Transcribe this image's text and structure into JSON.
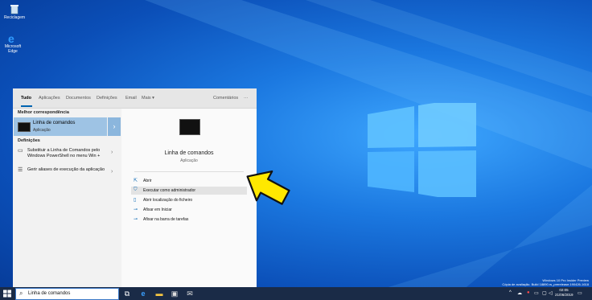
{
  "desktop": {
    "icons": [
      {
        "label": "Reciclagem",
        "icon": "recycle-bin-icon"
      },
      {
        "label": "Microsoft Edge",
        "icon": "edge-icon"
      }
    ],
    "watermark": {
      "line1": "Windows 10 Pro Insider Preview",
      "line2": "Cópia de avaliação. Build 18890.rs_prerelease.190426-1618"
    }
  },
  "search_panel": {
    "tabs": [
      "Tudo",
      "Aplicações",
      "Documentos",
      "Definições",
      "Email",
      "Mais ▾"
    ],
    "feedback": "Comentários",
    "more_options": "···",
    "best_match_header": "Melhor correspondência",
    "best_match": {
      "title": "Linha de comandos",
      "subtitle": "Aplicação"
    },
    "settings_header": "Definições",
    "settings_items": [
      {
        "text": "Substituir a Linha de Comandos pelo Windows PowerShell no menu Win +",
        "icon": "monitor-icon"
      },
      {
        "text": "Gerir aliases de execução da aplicação",
        "icon": "list-icon"
      }
    ],
    "preview": {
      "title": "Linha de comandos",
      "subtitle": "Aplicação",
      "actions": [
        {
          "label": "Abrir",
          "icon": "open-icon"
        },
        {
          "label": "Executar como administrador",
          "icon": "shield-run-icon"
        },
        {
          "label": "Abrir localização do ficheiro",
          "icon": "file-location-icon"
        },
        {
          "label": "Afixar em Iniciar",
          "icon": "pin-icon"
        },
        {
          "label": "Afixar na barra de tarefas",
          "icon": "pin-taskbar-icon"
        }
      ]
    }
  },
  "taskbar": {
    "search_value": "Linha de comandos",
    "clock_time": "02:05",
    "clock_date": "21/06/2019"
  },
  "colors": {
    "accent": "#0063b1",
    "highlight": "#9ec3e4",
    "arrow": "#ffe800"
  }
}
